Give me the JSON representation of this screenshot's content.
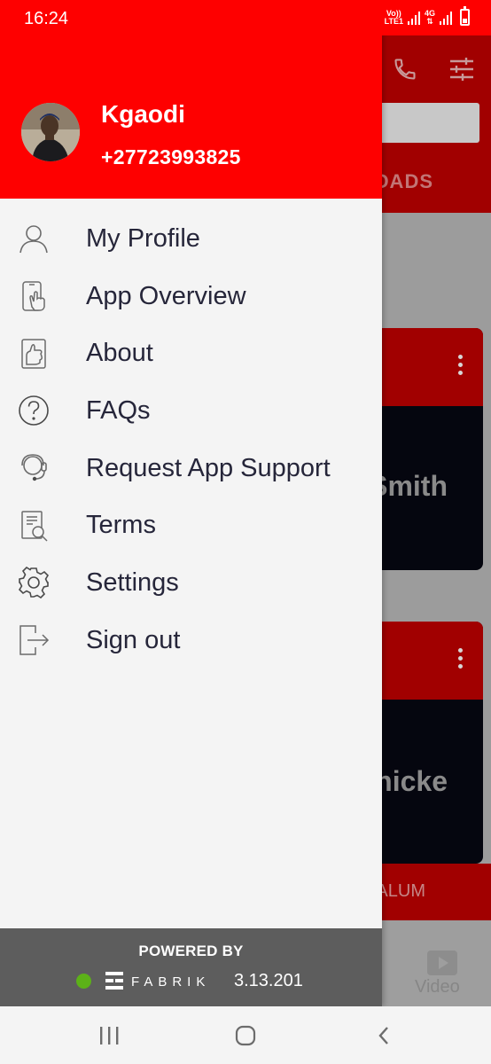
{
  "status_bar": {
    "time": "16:24",
    "network_label_1": "Vo))",
    "network_label_2": "LTE1",
    "network_label_3": "4G",
    "icons": [
      "volte-icon",
      "signal-icon",
      "4g-icon",
      "signal-icon",
      "battery-icon"
    ]
  },
  "background_app": {
    "tab_text": "OADS",
    "cards": [
      {
        "name_fragment": "Smith"
      },
      {
        "name_fragment": "Thicke"
      }
    ],
    "band_text": "ALUM",
    "bottom_nav_label": "Video"
  },
  "drawer": {
    "user": {
      "name": "Kgaodi",
      "phone": "+27723993825"
    },
    "menu": [
      {
        "label": "My Profile",
        "icon": "person-icon"
      },
      {
        "label": "App Overview",
        "icon": "touch-phone-icon"
      },
      {
        "label": "About",
        "icon": "about-hand-icon"
      },
      {
        "label": "FAQs",
        "icon": "question-circle-icon"
      },
      {
        "label": "Request App Support",
        "icon": "headset-icon"
      },
      {
        "label": "Terms",
        "icon": "document-search-icon"
      },
      {
        "label": "Settings",
        "icon": "gear-icon"
      },
      {
        "label": "Sign out",
        "icon": "sign-out-icon"
      }
    ],
    "footer": {
      "powered_by": "POWERED BY",
      "brand": "FABRIK",
      "version": "3.13.201",
      "status_color": "#5cb118"
    }
  },
  "colors": {
    "brand_red": "#fe0000",
    "drawer_bg": "#f4f4f4",
    "menu_text": "#26263a",
    "footer_bg": "#5d5d5d"
  }
}
